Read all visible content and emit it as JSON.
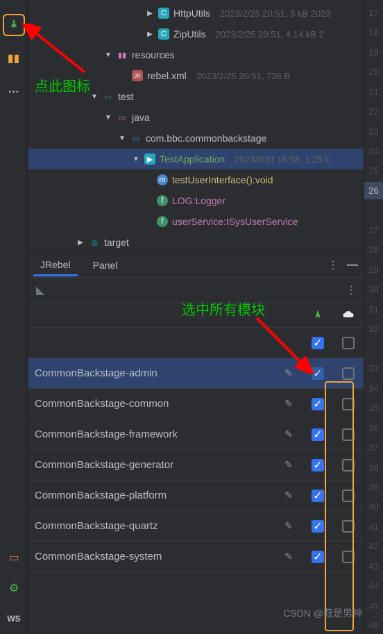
{
  "toolbar": {
    "ws": "WS"
  },
  "tree": {
    "http_utils": "HttpUtils",
    "http_meta": "2023/2/25 20:51, 3 kB 2023",
    "zip_utils": "ZipUtils",
    "zip_meta": "2023/2/25 20:51, 4.14 kB 2",
    "resources": "resources",
    "rebel_xml": "rebel.xml",
    "rebel_meta": "2023/2/25 20:51, 736 B",
    "test": "test",
    "java": "java",
    "pkg": "com.bbc.commonbackstage",
    "test_app": "TestApplication",
    "test_app_meta": "2023/8/31 16:58, 1.25 k",
    "method1": "testUserInterface():void",
    "field_log": "LOG:Logger",
    "field_us": "userService:ISysUserService",
    "target": "target"
  },
  "panel": {
    "tabs": [
      "JRebel",
      "Panel"
    ],
    "modules": [
      {
        "name": "",
        "sel": false,
        "c1": true,
        "c2": false
      },
      {
        "name": "CommonBackstage-admin",
        "sel": true,
        "c1": true,
        "c2": false
      },
      {
        "name": "CommonBackstage-common",
        "sel": false,
        "c1": true,
        "c2": false
      },
      {
        "name": "CommonBackstage-framework",
        "sel": false,
        "c1": true,
        "c2": false
      },
      {
        "name": "CommonBackstage-generator",
        "sel": false,
        "c1": true,
        "c2": false
      },
      {
        "name": "CommonBackstage-platform",
        "sel": false,
        "c1": true,
        "c2": false
      },
      {
        "name": "CommonBackstage-quartz",
        "sel": false,
        "c1": true,
        "c2": false
      },
      {
        "name": "CommonBackstage-system",
        "sel": false,
        "c1": true,
        "c2": false
      }
    ]
  },
  "annotations": {
    "click_icon": "点此图标",
    "select_all": "选中所有模块"
  },
  "watermark": "CSDN @莪是男神",
  "gutter": [
    "17",
    "18",
    "19",
    "20",
    "21",
    "22",
    "23",
    "24",
    "25",
    "26",
    "",
    "27",
    "28",
    "29",
    "30",
    "31",
    "32",
    "",
    "33",
    "34",
    "35",
    "36",
    "37",
    "38",
    "39",
    "40",
    "41",
    "42",
    "43",
    "44",
    "45",
    "46"
  ]
}
